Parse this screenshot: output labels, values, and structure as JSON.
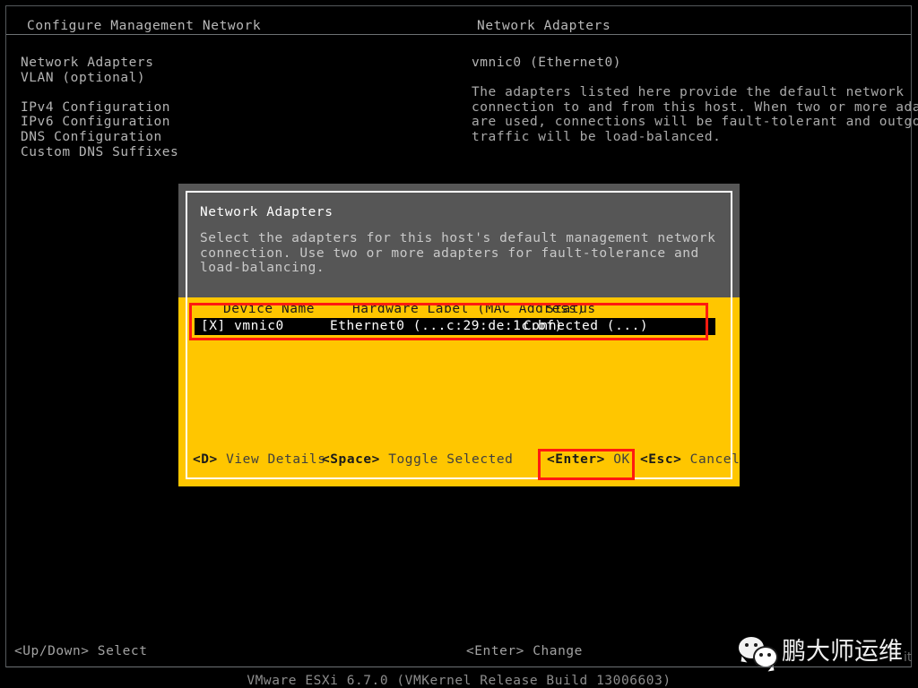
{
  "colors": {
    "background": "#000000",
    "frame_border": "#55595c",
    "text": "#b4b4b4",
    "dialog_header_bg": "#565656",
    "dialog_body_bg": "#ffc600",
    "dialog_border": "#ffffff",
    "selection_bg": "#000000",
    "selection_text": "#ffffff",
    "annotation_red": "#ff1a10"
  },
  "header": {
    "left_title": "Configure Management Network",
    "right_title": "Network Adapters"
  },
  "left_pane": {
    "items": [
      {
        "label": "Network Adapters"
      },
      {
        "label": "VLAN (optional)"
      },
      {
        "label": ""
      },
      {
        "label": "IPv4 Configuration"
      },
      {
        "label": "IPv6 Configuration"
      },
      {
        "label": "DNS Configuration"
      },
      {
        "label": "Custom DNS Suffixes"
      }
    ]
  },
  "right_pane": {
    "heading": "vmnic0 (Ethernet0)",
    "body_lines": [
      "The adapters listed here provide the default network",
      "connection to and from this host. When two or more adapters",
      "are used, connections will be fault-tolerant and outgoing",
      "traffic will be load-balanced."
    ]
  },
  "dialog": {
    "title": "Network Adapters",
    "description_lines": [
      "Select the adapters for this host's default management network",
      "connection. Use two or more adapters for fault-tolerance and",
      "load-balancing."
    ],
    "table": {
      "columns": [
        "Device Name",
        "Hardware Label (MAC Address)",
        "Status"
      ],
      "rows": [
        {
          "checkbox": "[X]",
          "device_name": "vmnic0",
          "hardware_label": "Ethernet0 (...c:29:de:1c:bf)",
          "status": "Connected (...)",
          "selected": true
        }
      ]
    },
    "footer_hints": [
      {
        "key": "<D>",
        "label": " View Details"
      },
      {
        "key": "<Space>",
        "label": " Toggle Selected"
      },
      {
        "key": "<Enter>",
        "label": " OK"
      },
      {
        "key": "<Esc>",
        "label": " Cancel"
      }
    ]
  },
  "status_bar": {
    "left_hint_key": "<Up/Down>",
    "left_hint_label": " Select",
    "mid_hint_key": "<Enter>",
    "mid_hint_label": " Change"
  },
  "version_line": "VMware ESXi 6.7.0 (VMKernel Release Build 13006603)",
  "watermark": {
    "logo": "wechat-logo",
    "text": "鹏大师运维",
    "suffix": "it"
  }
}
